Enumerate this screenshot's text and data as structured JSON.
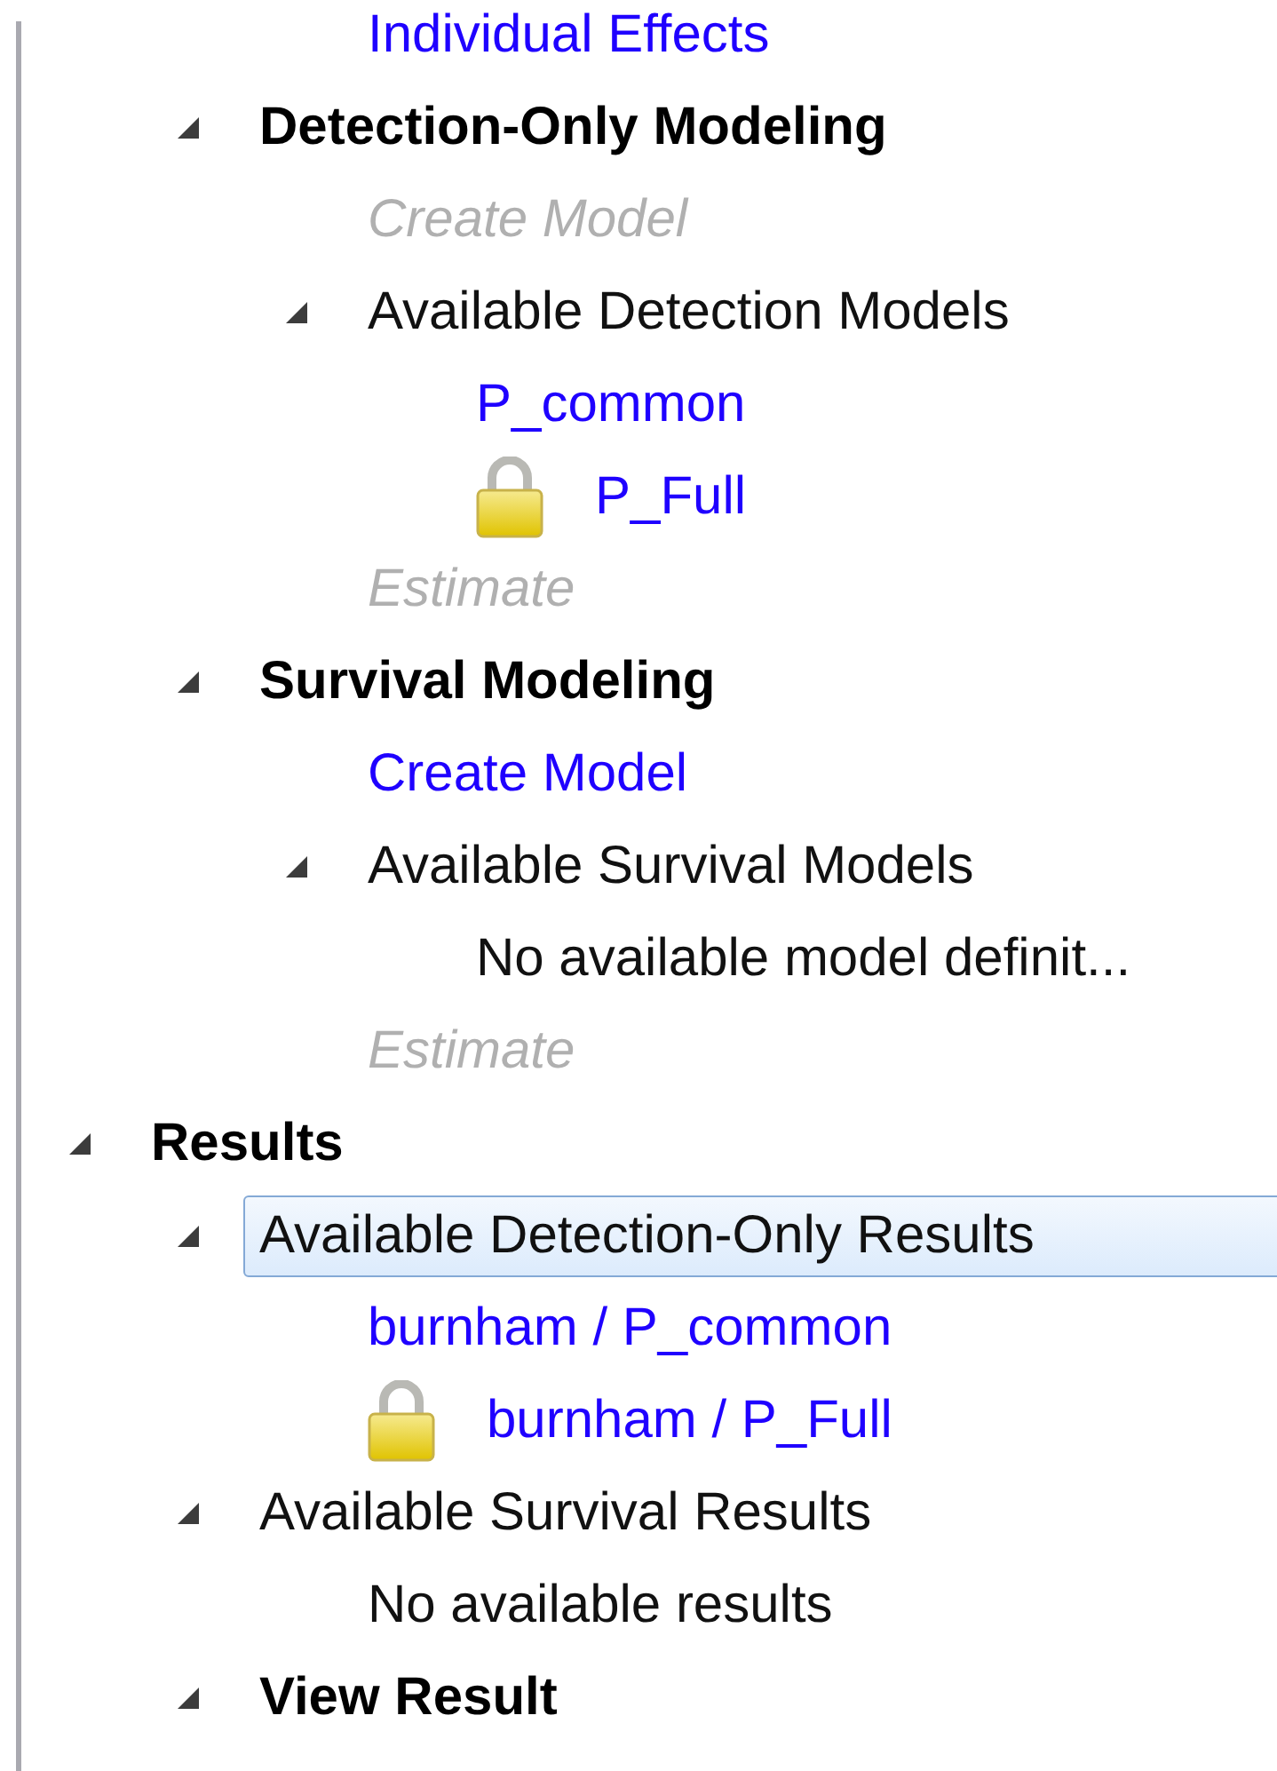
{
  "tree": {
    "items": [
      {
        "children": [
          {
            "children": [
              {
                "label": "Individual Effects",
                "kind": "link",
                "selected": false
              }
            ]
          },
          {
            "label": "Detection-Only Modeling",
            "kind": "heading",
            "expanded": true,
            "selected": false,
            "children": [
              {
                "label": "Create Model",
                "kind": "disabled",
                "selected": false
              },
              {
                "label": "Available Detection Models",
                "kind": "plain",
                "expanded": true,
                "selected": false,
                "children": [
                  {
                    "label": "P_common",
                    "kind": "link",
                    "selected": false
                  },
                  {
                    "label": "P_Full",
                    "kind": "link",
                    "locked": true,
                    "selected": false
                  }
                ]
              },
              {
                "label": "Estimate",
                "kind": "disabled",
                "selected": false
              }
            ]
          },
          {
            "label": "Survival Modeling",
            "kind": "heading",
            "expanded": true,
            "selected": false,
            "children": [
              {
                "label": "Create Model",
                "kind": "link",
                "selected": false
              },
              {
                "label": "Available Survival Models",
                "kind": "plain",
                "expanded": true,
                "selected": false,
                "children": [
                  {
                    "label": "No available model definit...",
                    "kind": "plain",
                    "selected": false
                  }
                ]
              },
              {
                "label": "Estimate",
                "kind": "disabled",
                "selected": false
              }
            ]
          }
        ]
      },
      {
        "label": "Results",
        "kind": "heading",
        "expanded": true,
        "selected": false,
        "children": [
          {
            "label": "Available Detection-Only Results",
            "kind": "plain",
            "expanded": true,
            "selected": true,
            "children": [
              {
                "label": "burnham / P_common",
                "kind": "link",
                "selected": false
              },
              {
                "label": "burnham / P_Full",
                "kind": "link",
                "locked": true,
                "selected": false
              }
            ]
          },
          {
            "label": "Available Survival Results",
            "kind": "plain",
            "expanded": true,
            "selected": false,
            "children": [
              {
                "label": "No available results",
                "kind": "plain",
                "selected": false
              }
            ]
          },
          {
            "label": "View Result",
            "kind": "heading",
            "expanded": true,
            "selected": false
          }
        ]
      }
    ]
  }
}
